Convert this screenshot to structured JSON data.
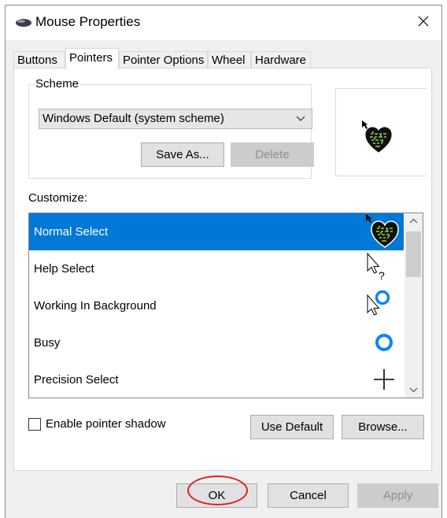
{
  "window": {
    "title": "Mouse Properties"
  },
  "tabs": [
    {
      "label": "Buttons"
    },
    {
      "label": "Pointers",
      "active": true
    },
    {
      "label": "Pointer Options"
    },
    {
      "label": "Wheel"
    },
    {
      "label": "Hardware"
    }
  ],
  "scheme": {
    "label": "Scheme",
    "selected": "Windows Default (system scheme)",
    "save_as_label": "Save As...",
    "delete_label": "Delete"
  },
  "customize": {
    "label": "Customize:",
    "items": [
      {
        "label": "Normal Select",
        "cursor_icon": "heart-arrow-cursor-icon",
        "selected": true
      },
      {
        "label": "Help Select",
        "cursor_icon": "help-select-cursor-icon"
      },
      {
        "label": "Working In Background",
        "cursor_icon": "working-background-cursor-icon"
      },
      {
        "label": "Busy",
        "cursor_icon": "busy-ring-cursor-icon"
      },
      {
        "label": "Precision Select",
        "cursor_icon": "crosshair-cursor-icon"
      }
    ]
  },
  "shadow": {
    "label": "Enable pointer shadow",
    "checked": false
  },
  "buttons": {
    "use_default": "Use Default",
    "browse": "Browse...",
    "ok": "OK",
    "cancel": "Cancel",
    "apply": "Apply"
  },
  "colors": {
    "selection": "#0078d7",
    "annotation_ring": "#e01e1e",
    "busy_ring": "#0a84ff"
  }
}
